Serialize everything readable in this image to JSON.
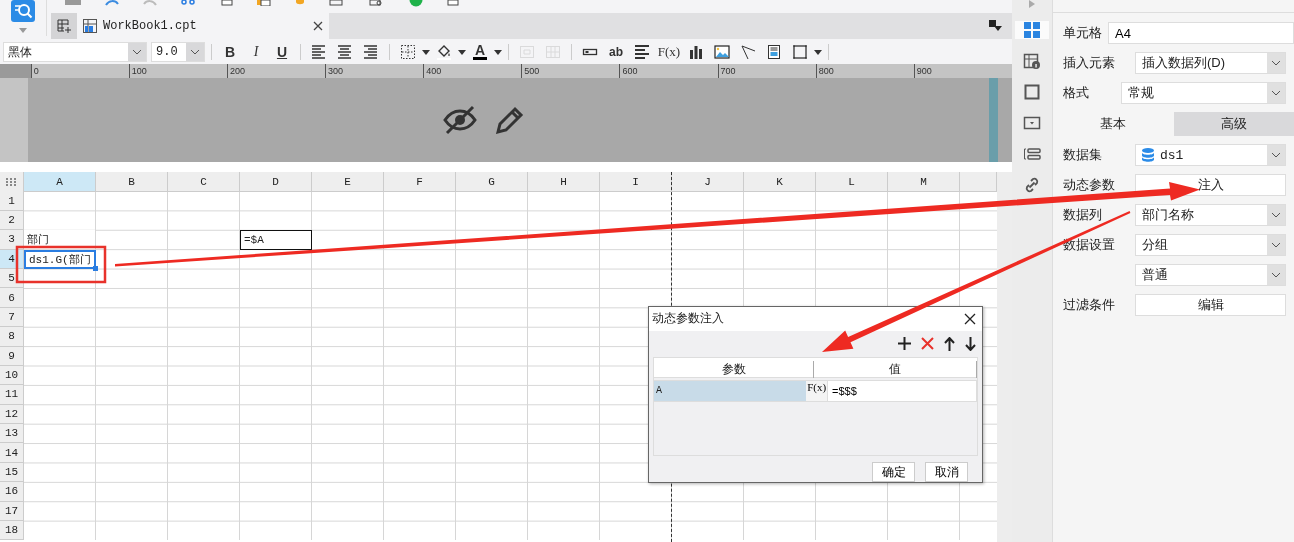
{
  "tab": {
    "title": "WorkBook1.cpt"
  },
  "format_toolbar": {
    "font": "黑体",
    "size": "9.0",
    "items": [
      {
        "kind": "bold",
        "label": "B",
        "disabled": false
      },
      {
        "kind": "italic",
        "label": "I",
        "disabled": false
      },
      {
        "kind": "underline",
        "label": "U",
        "disabled": false
      },
      {
        "kind": "align-left",
        "disabled": false
      },
      {
        "kind": "align-center",
        "disabled": false
      },
      {
        "kind": "align-right",
        "disabled": false
      },
      {
        "kind": "border",
        "disabled": false
      },
      {
        "kind": "fill",
        "disabled": false
      },
      {
        "kind": "font-color",
        "label": "A",
        "disabled": false
      },
      {
        "kind": "merge",
        "disabled": true
      },
      {
        "kind": "unmerge",
        "disabled": true
      },
      {
        "kind": "field",
        "disabled": false
      },
      {
        "kind": "text",
        "label": "ab",
        "disabled": false
      },
      {
        "kind": "rich-text",
        "disabled": false
      },
      {
        "kind": "formula",
        "label": "F(x)",
        "disabled": false
      },
      {
        "kind": "chart",
        "disabled": false
      },
      {
        "kind": "image",
        "disabled": false
      },
      {
        "kind": "slash",
        "disabled": false
      },
      {
        "kind": "subreport",
        "disabled": false
      },
      {
        "kind": "frame",
        "disabled": false
      }
    ]
  },
  "ruler": {
    "ticks": [
      "0",
      "100",
      "200",
      "300",
      "400",
      "500",
      "600",
      "700",
      "800",
      "900"
    ]
  },
  "sheet": {
    "columns": [
      {
        "label": "A",
        "selected": true,
        "page_break": false
      },
      {
        "label": "B",
        "selected": false,
        "page_break": false
      },
      {
        "label": "C",
        "selected": false,
        "page_break": false
      },
      {
        "label": "D",
        "selected": false,
        "page_break": false
      },
      {
        "label": "E",
        "selected": false,
        "page_break": false
      },
      {
        "label": "F",
        "selected": false,
        "page_break": false
      },
      {
        "label": "G",
        "selected": false,
        "page_break": false
      },
      {
        "label": "H",
        "selected": false,
        "page_break": false
      },
      {
        "label": "I",
        "selected": false,
        "page_break": true
      },
      {
        "label": "J",
        "selected": false,
        "page_break": false
      },
      {
        "label": "K",
        "selected": false,
        "page_break": false
      },
      {
        "label": "L",
        "selected": false,
        "page_break": false
      },
      {
        "label": "M",
        "selected": false,
        "page_break": false
      }
    ],
    "rows": [
      {
        "label": "1",
        "selected": false
      },
      {
        "label": "2",
        "selected": false
      },
      {
        "label": "3",
        "selected": false,
        "cells": [
          {
            "text": "部门",
            "selected": false,
            "bordered": false
          },
          {
            "selected": false
          },
          {
            "selected": false
          },
          {
            "text": "=$A",
            "selected": false,
            "bordered": true
          }
        ]
      },
      {
        "label": "4",
        "selected": true,
        "cells": [
          {
            "text": "ds1.G(部门",
            "selected": true
          }
        ]
      },
      {
        "label": "5",
        "selected": false
      },
      {
        "label": "6",
        "selected": false
      },
      {
        "label": "7",
        "selected": false
      },
      {
        "label": "8",
        "selected": false
      },
      {
        "label": "9",
        "selected": false
      },
      {
        "label": "10",
        "selected": false
      },
      {
        "label": "11",
        "selected": false
      },
      {
        "label": "12",
        "selected": false
      },
      {
        "label": "13",
        "selected": false
      },
      {
        "label": "14",
        "selected": false
      },
      {
        "label": "15",
        "selected": false
      },
      {
        "label": "16",
        "selected": false
      },
      {
        "label": "17",
        "selected": false
      },
      {
        "label": "18",
        "selected": false
      }
    ]
  },
  "side_tools": [
    {
      "kind": "cell-element",
      "selected": true
    },
    {
      "kind": "attributes",
      "selected": false
    },
    {
      "kind": "frame",
      "selected": false
    },
    {
      "kind": "widget",
      "selected": false
    },
    {
      "kind": "form",
      "selected": false
    },
    {
      "kind": "link",
      "selected": false
    }
  ],
  "properties": {
    "fields": [
      {
        "label": "单元格",
        "kind": "input",
        "value": "A4"
      },
      {
        "label": "插入元素",
        "kind": "select",
        "value": "插入数据列(D)"
      },
      {
        "label": "格式",
        "kind": "select",
        "value": "常规"
      }
    ],
    "tabs": [
      {
        "label": "基本",
        "selected": true
      },
      {
        "label": "高级",
        "selected": false
      }
    ],
    "data_fields": [
      {
        "label": "数据集",
        "kind": "dataset",
        "value": "ds1"
      },
      {
        "label": "动态参数",
        "kind": "button",
        "value": "注入"
      },
      {
        "label": "数据列",
        "kind": "select",
        "value": "部门名称"
      },
      {
        "label": "数据设置",
        "kind": "select",
        "value": "分组"
      },
      {
        "kind": "select",
        "value": "普通"
      },
      {
        "label": "过滤条件",
        "kind": "button",
        "value": "编辑"
      }
    ]
  },
  "dialog": {
    "title": "动态参数注入",
    "columns": [
      "参数",
      "值"
    ],
    "formula_label": "F(x)",
    "rows": [
      {
        "param": "A",
        "value": "=$$$",
        "selected": true
      }
    ],
    "buttons": [
      "确定",
      "取消"
    ]
  }
}
